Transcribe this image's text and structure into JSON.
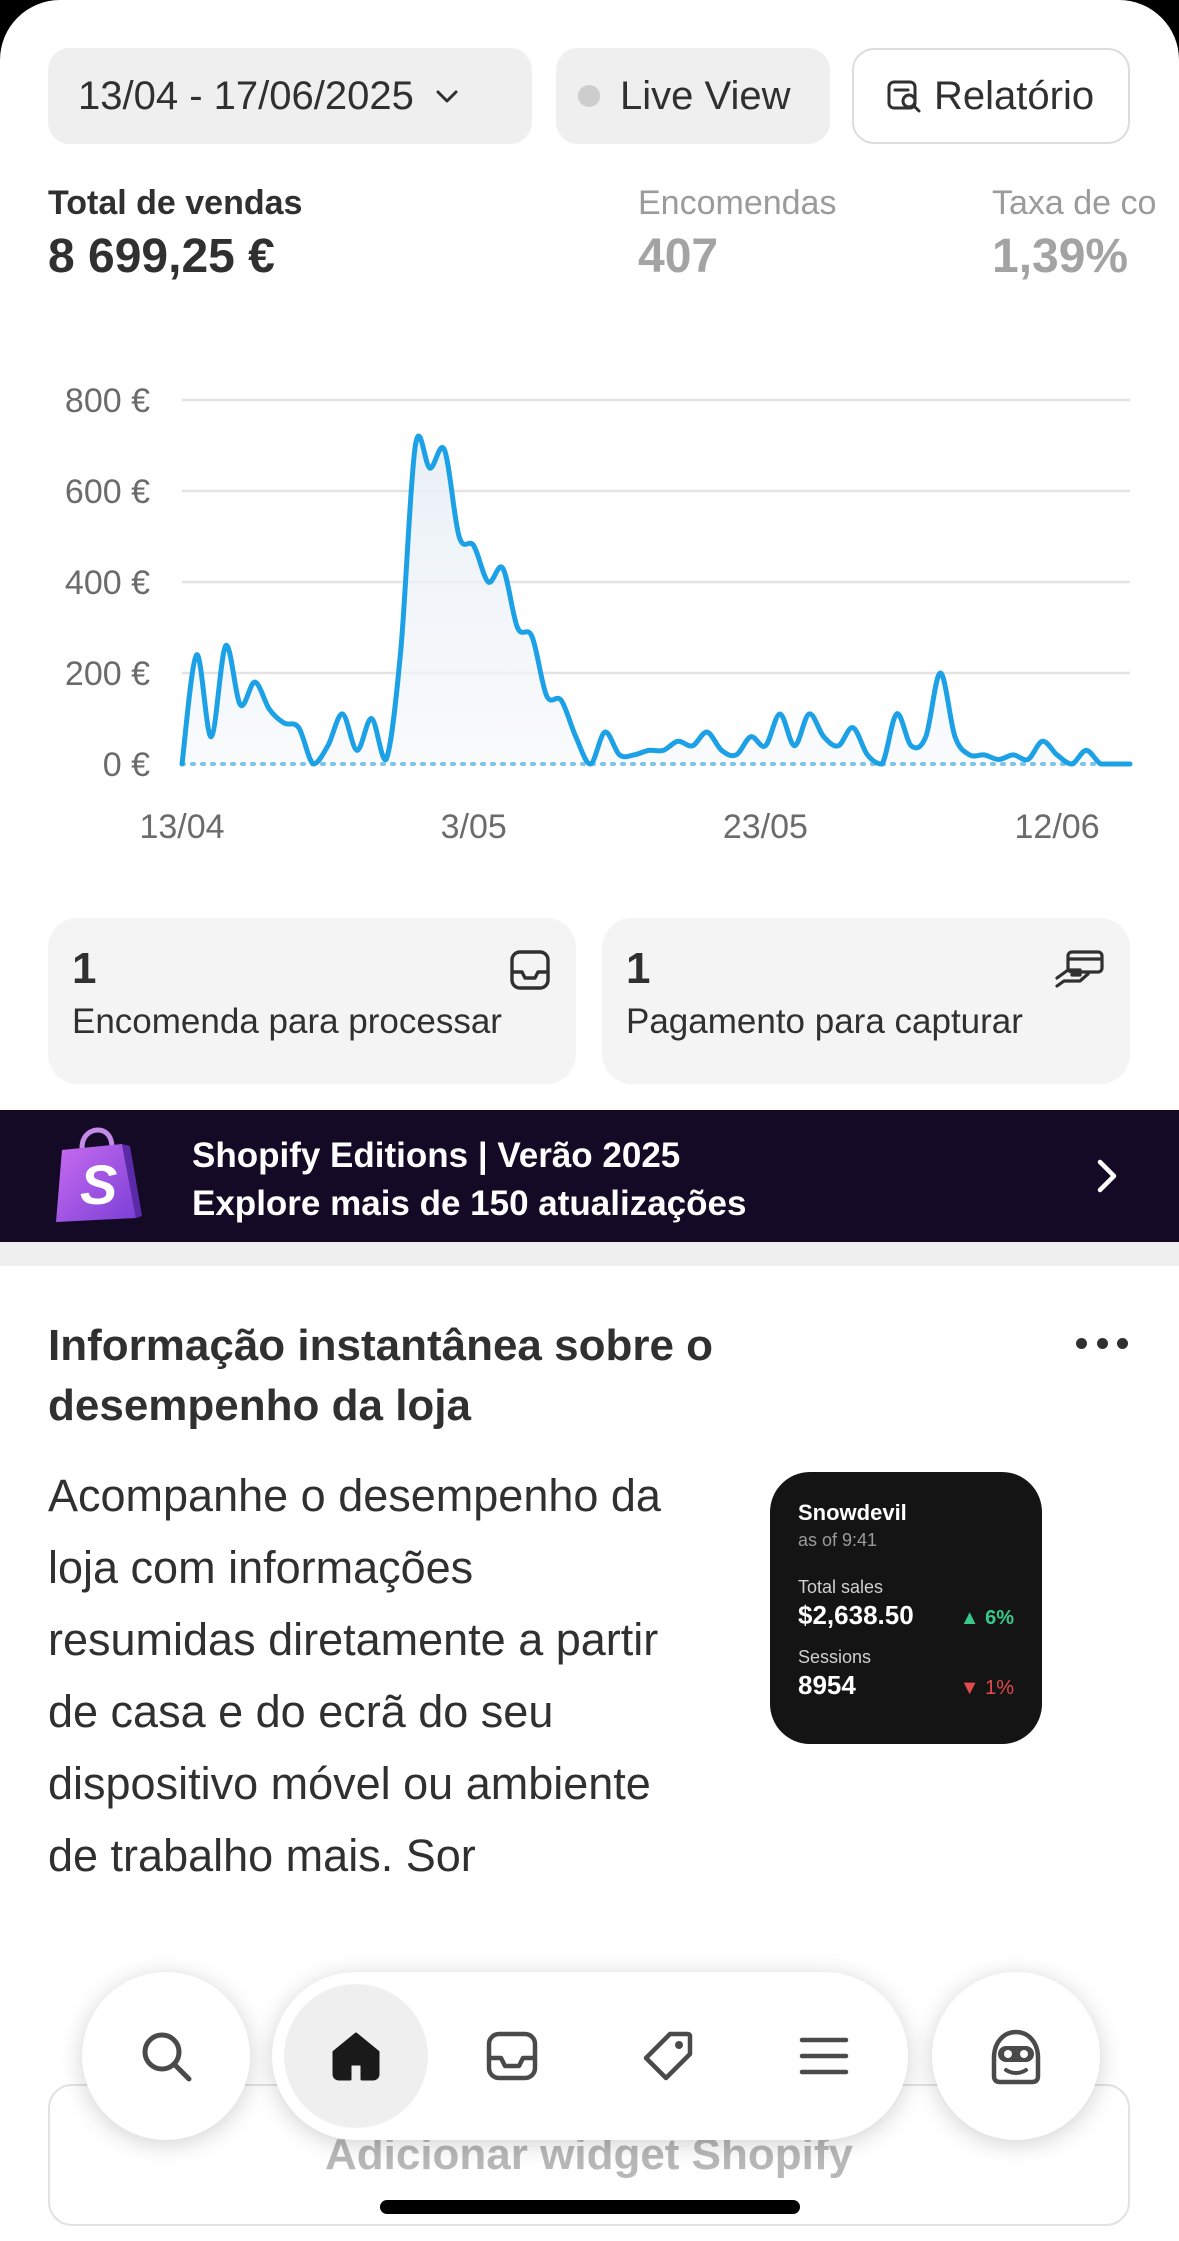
{
  "header": {
    "date_range": "13/04 - 17/06/2025",
    "live_view": "Live View",
    "report": "Relatório"
  },
  "metrics": [
    {
      "label": "Total de vendas",
      "value": "8 699,25 €"
    },
    {
      "label": "Encomendas",
      "value": "407"
    },
    {
      "label": "Taxa de co",
      "value": "1,39%"
    }
  ],
  "chart_data": {
    "type": "line",
    "y_ticks": [
      "800 €",
      "600 €",
      "400 €",
      "200 €",
      "0 €"
    ],
    "x_ticks": [
      "13/04",
      "3/05",
      "23/05",
      "12/06"
    ],
    "ylim": [
      0,
      800
    ],
    "grid": true,
    "colors": {
      "line": "#1da1e6",
      "baseline": "#7cc4ea"
    },
    "x": [
      "13/04",
      "14/04",
      "15/04",
      "16/04",
      "17/04",
      "18/04",
      "19/04",
      "20/04",
      "21/04",
      "22/04",
      "23/04",
      "24/04",
      "25/04",
      "26/04",
      "27/04",
      "28/04",
      "29/04",
      "30/04",
      "1/05",
      "2/05",
      "3/05",
      "4/05",
      "5/05",
      "6/05",
      "7/05",
      "8/05",
      "9/05",
      "10/05",
      "11/05",
      "12/05",
      "13/05",
      "14/05",
      "15/05",
      "16/05",
      "17/05",
      "18/05",
      "19/05",
      "20/05",
      "21/05",
      "22/05",
      "23/05",
      "24/05",
      "25/05",
      "26/05",
      "27/05",
      "28/05",
      "29/05",
      "30/05",
      "31/05",
      "1/06",
      "2/06",
      "3/06",
      "4/06",
      "5/06",
      "6/06",
      "7/06",
      "8/06",
      "9/06",
      "10/06",
      "11/06",
      "12/06",
      "13/06",
      "14/06",
      "15/06",
      "16/06",
      "17/06"
    ],
    "values": [
      0,
      240,
      60,
      260,
      130,
      180,
      120,
      90,
      80,
      0,
      40,
      110,
      30,
      100,
      10,
      250,
      700,
      650,
      690,
      500,
      480,
      400,
      430,
      300,
      280,
      150,
      140,
      60,
      0,
      70,
      20,
      20,
      30,
      30,
      50,
      40,
      70,
      30,
      20,
      60,
      40,
      110,
      40,
      110,
      60,
      40,
      80,
      20,
      0,
      110,
      40,
      60,
      200,
      60,
      20,
      20,
      10,
      20,
      10,
      50,
      20,
      0,
      30,
      0,
      0,
      0
    ]
  },
  "tasks": [
    {
      "count": "1",
      "label": "Encomenda para processar",
      "icon": "inbox-icon"
    },
    {
      "count": "1",
      "label": "Pagamento para capturar",
      "icon": "payment-hand-icon"
    }
  ],
  "banner": {
    "line1": "Shopify Editions | Verão 2025",
    "line2": "Explore mais de 150 atualizações",
    "brand_color": "#95bf47"
  },
  "card": {
    "title": "Informação instantânea sobre o desempenho da loja",
    "body": "Acompanhe o desempenho da loja com informações resumidas diretamente a partir de casa e do ecrã do seu dispositivo móvel ou ambiente de trabalho mais. Sor"
  },
  "widget": {
    "store": "Snowdevil",
    "as_of": "as of 9:41",
    "sales_label": "Total sales",
    "sales_value": "$2,638.50",
    "sales_change": "6%",
    "sessions_label": "Sessions",
    "sessions_value": "8954",
    "sessions_change": "1%"
  },
  "add_widget": "Adicionar widget Shopify",
  "nav": [
    "search-icon",
    "home-icon",
    "inbox-icon",
    "tag-icon",
    "menu-icon",
    "avatar-icon"
  ]
}
